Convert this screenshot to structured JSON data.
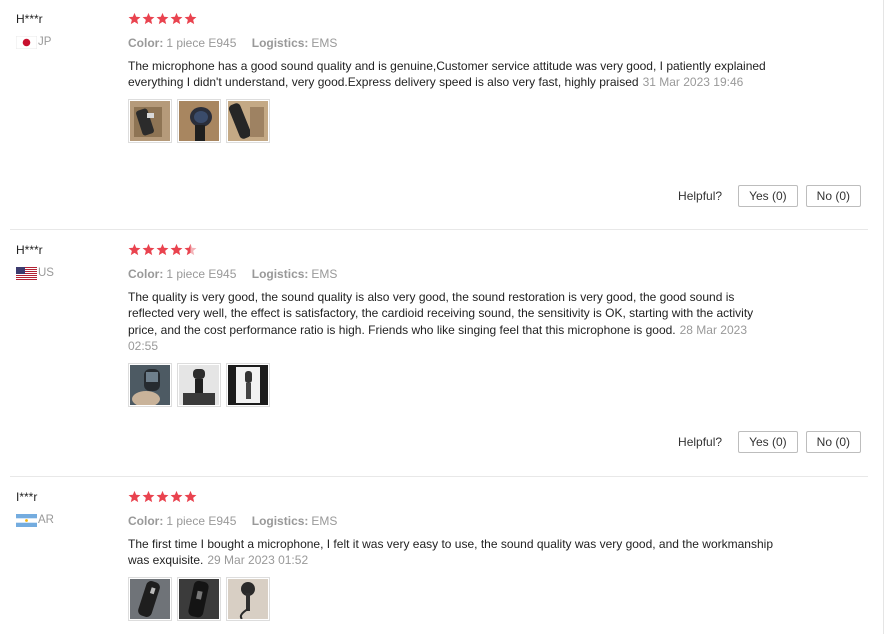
{
  "labels": {
    "color_key": "Color:",
    "logistics_key": "Logistics:",
    "helpful": "Helpful?"
  },
  "reviews": [
    {
      "user": "H***r",
      "country": "JP",
      "rating": 5,
      "color": "1 piece E945",
      "logistics": "EMS",
      "text": "The microphone has a good sound quality and is genuine,Customer service attitude was very good, I patiently explained everything I didn't understand, very good.Express delivery speed is also very fast, highly praised",
      "date": "31 Mar 2023 19:46",
      "yes": "Yes (0)",
      "no": "No (0)"
    },
    {
      "user": "H***r",
      "country": "US",
      "rating": 4.5,
      "color": "1 piece E945",
      "logistics": "EMS",
      "text": "The quality is very good, the sound quality is also very good, the sound restoration is very good, the good sound is reflected very well, the effect is satisfactory, the cardioid receiving sound, the sensitivity is OK, starting with the activity price, and the cost performance ratio is high. Friends who like singing feel that this microphone is good.",
      "date": "28 Mar 2023 02:55",
      "yes": "Yes (0)",
      "no": "No (0)"
    },
    {
      "user": "I***r",
      "country": "AR",
      "rating": 5,
      "color": "1 piece E945",
      "logistics": "EMS",
      "text": "The first time I bought a microphone, I felt it was very easy to use, the sound quality was very good, and the workmanship was exquisite.",
      "date": "29 Mar 2023 01:52"
    }
  ],
  "colors": {
    "star": "#e9434f",
    "muted": "#999999",
    "border": "#bdbdbd"
  }
}
